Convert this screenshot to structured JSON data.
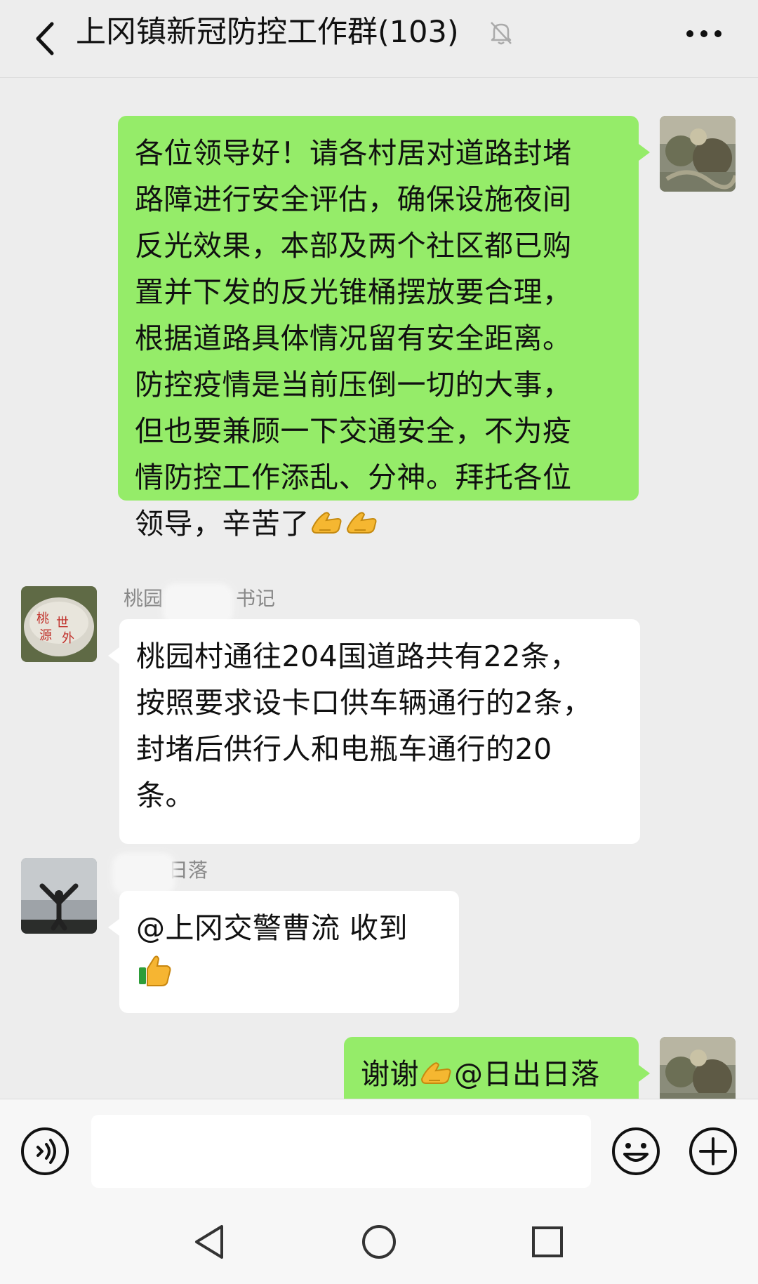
{
  "header": {
    "title": "上冈镇新冠防控工作群(103)",
    "back_icon": "chevron-left-icon",
    "mute_icon": "bell-muted-icon",
    "more_icon": "more-dots-icon"
  },
  "messages": [
    {
      "direction": "out",
      "sender": "",
      "lines": [
        "各位领导好！请各村居对道路封堵",
        "路障进行安全评估，确保设施夜间",
        "反光效果，本部及两个社区都已购",
        "置并下发的反光锥桶摆放要合理，",
        "根据道路具体情况留有安全距离。",
        "防控疫情是当前压倒一切的大事，",
        "但也要兼顾一下交通安全，不为疫",
        "情防控工作添乱、分神。拜托各位",
        "领导，辛苦了"
      ],
      "emoji": [
        "fist-bump-icon",
        "fist-bump-icon"
      ]
    },
    {
      "direction": "in",
      "sender_prefix": "桃园",
      "sender_suffix": "书记",
      "lines": [
        "桃园村通往204国道路共有22条，",
        "按照要求设卡口供车辆通行的2条，",
        "封堵后供行人和电瓶车通行的20",
        "条。"
      ]
    },
    {
      "direction": "in",
      "sender_suffix": "日落",
      "lines": [
        "@上冈交警曹流  收到"
      ],
      "emoji": [
        "thumbs-up-icon"
      ]
    },
    {
      "direction": "out",
      "text_before": "谢谢",
      "text_after": "@日出日落",
      "emoji": [
        "fist-bump-icon"
      ]
    }
  ],
  "input": {
    "value": "",
    "placeholder": ""
  },
  "colors": {
    "outgoing_bubble": "#95ec69",
    "incoming_bubble": "#ffffff",
    "background": "#ededed"
  }
}
